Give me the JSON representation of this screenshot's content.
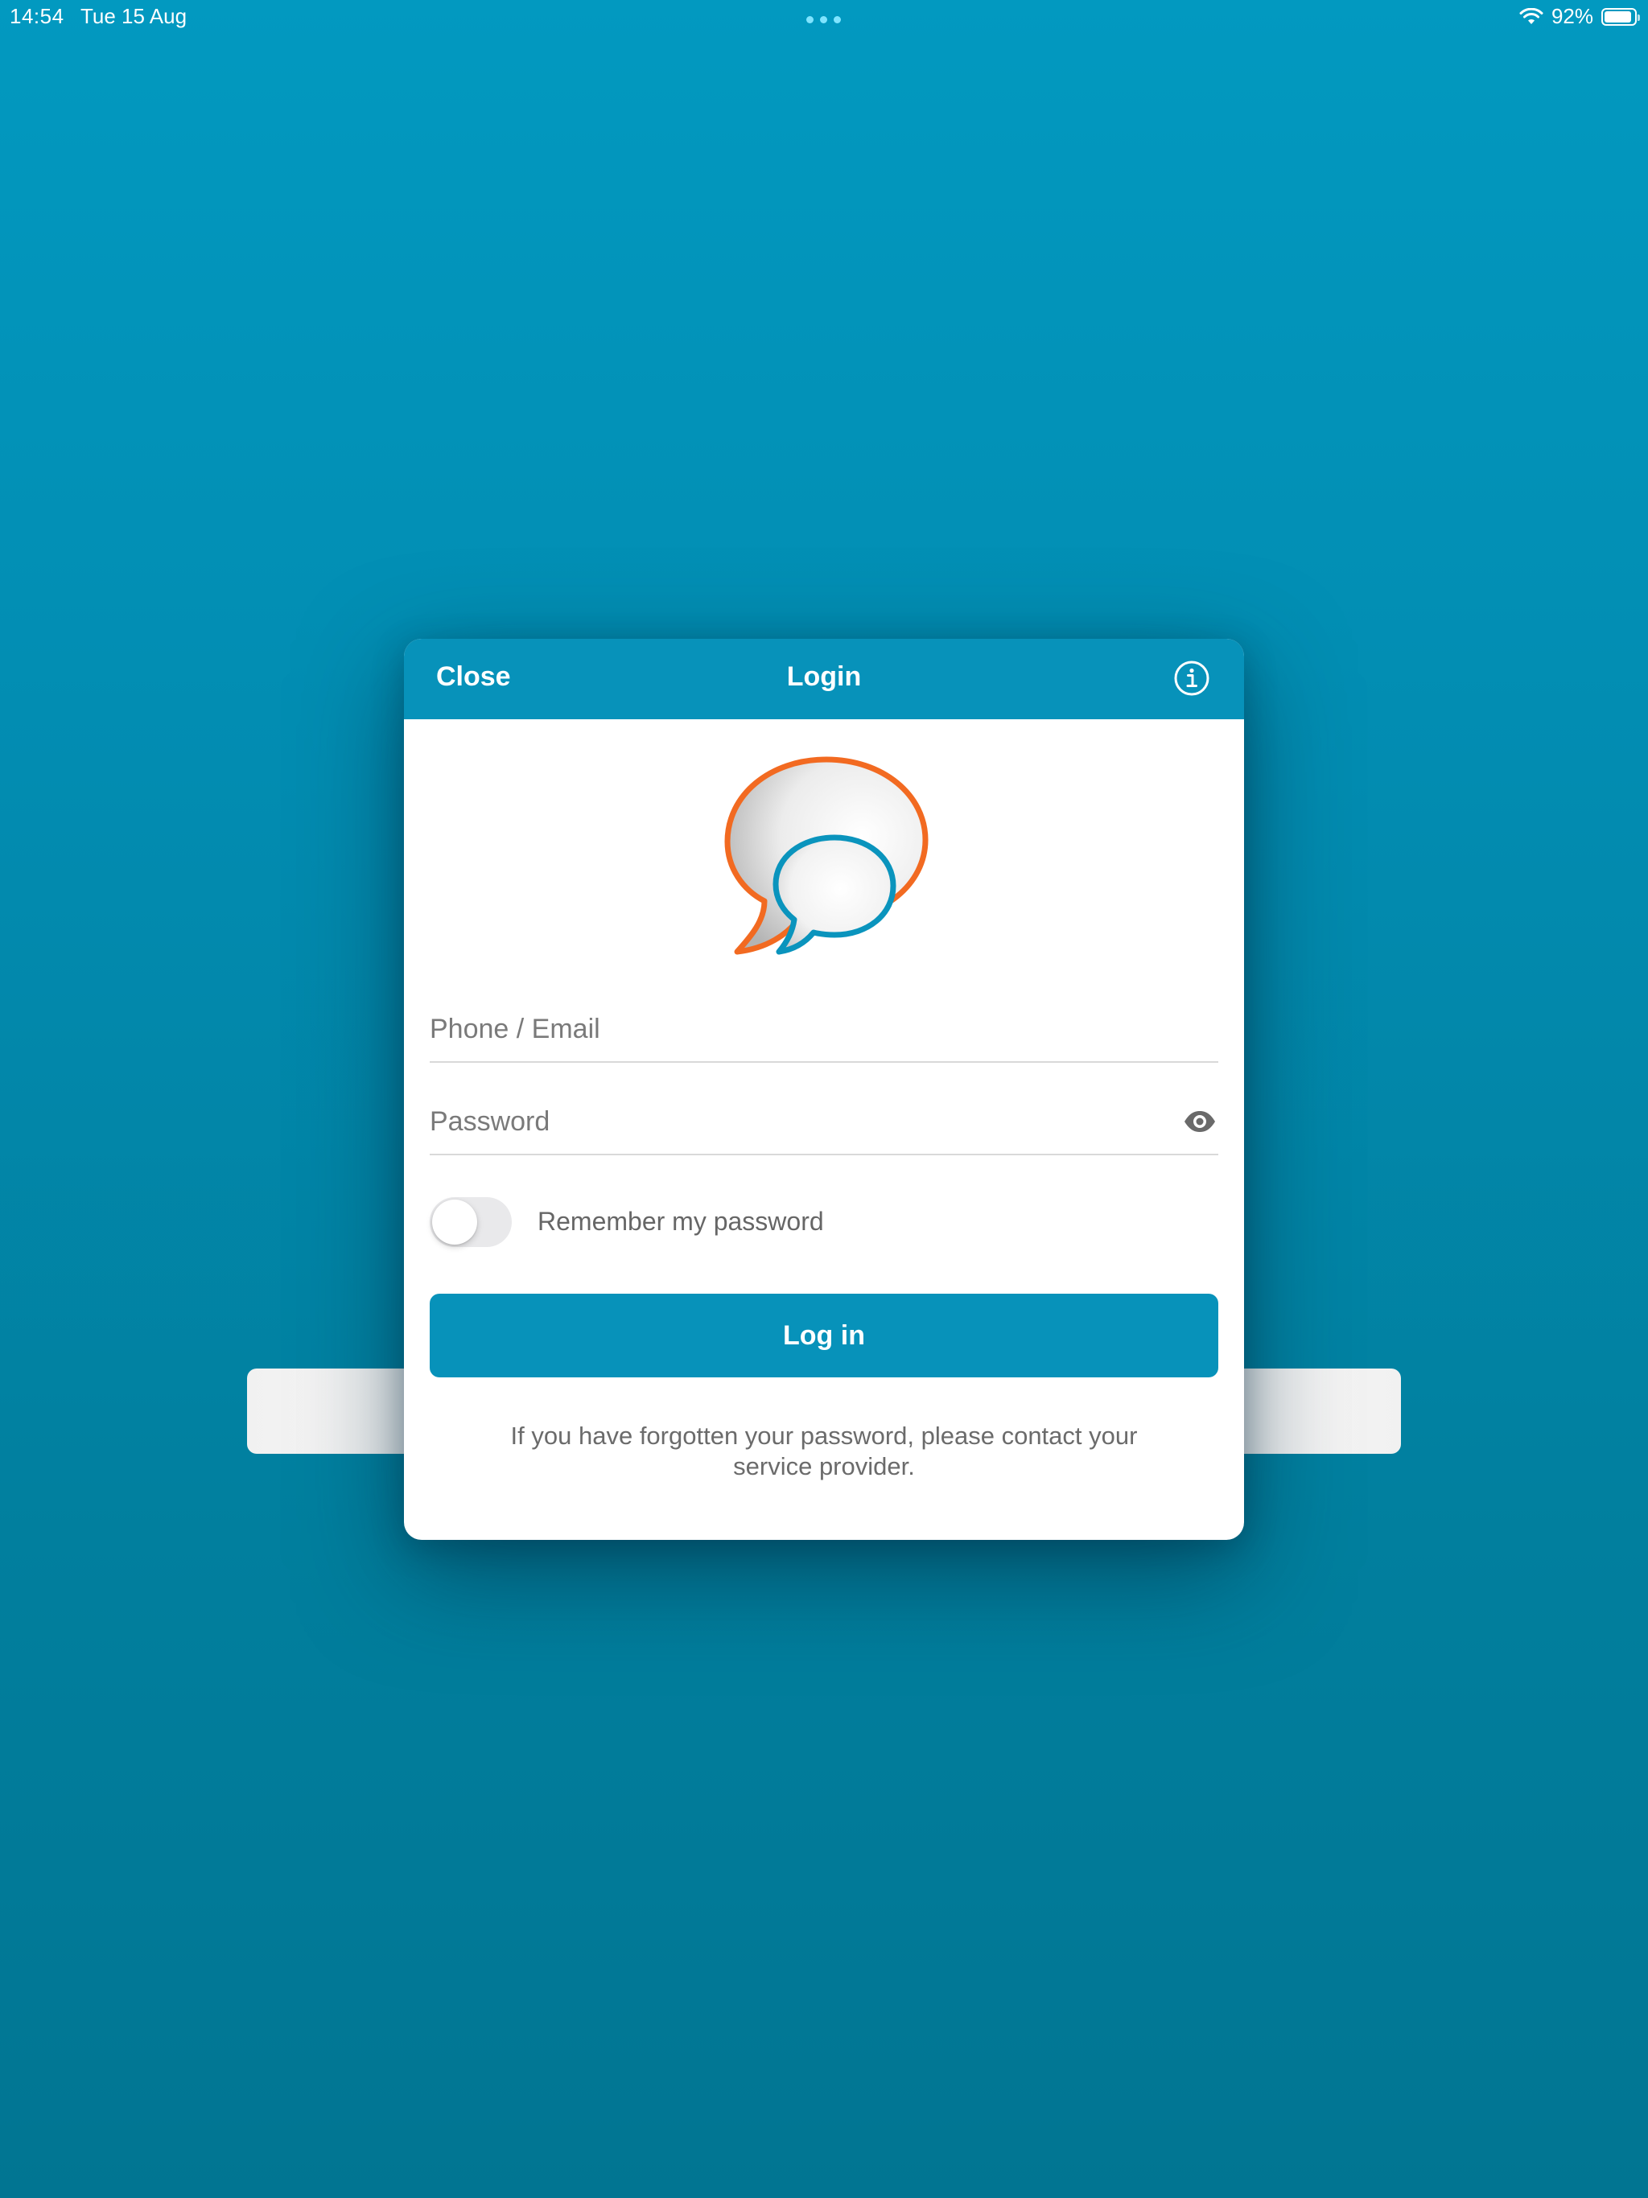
{
  "status_bar": {
    "time": "14:54",
    "date": "Tue 15 Aug",
    "battery_text": "92%",
    "battery_level": 0.92
  },
  "modal": {
    "close_label": "Close",
    "title": "Login",
    "phone_placeholder": "Phone / Email",
    "password_placeholder": "Password",
    "remember_label": "Remember my password",
    "remember_on": false,
    "login_label": "Log in",
    "forgot_text": "If you have forgotten your password, please contact your service provider."
  },
  "colors": {
    "accent": "#0792ba",
    "logo_orange": "#f26a21",
    "logo_blue": "#0a94bd"
  },
  "icons": {
    "info": "info-circle-icon",
    "eye": "eye-icon",
    "logo": "chat-bubbles-logo-icon",
    "wifi": "wifi-icon",
    "battery": "battery-icon"
  }
}
